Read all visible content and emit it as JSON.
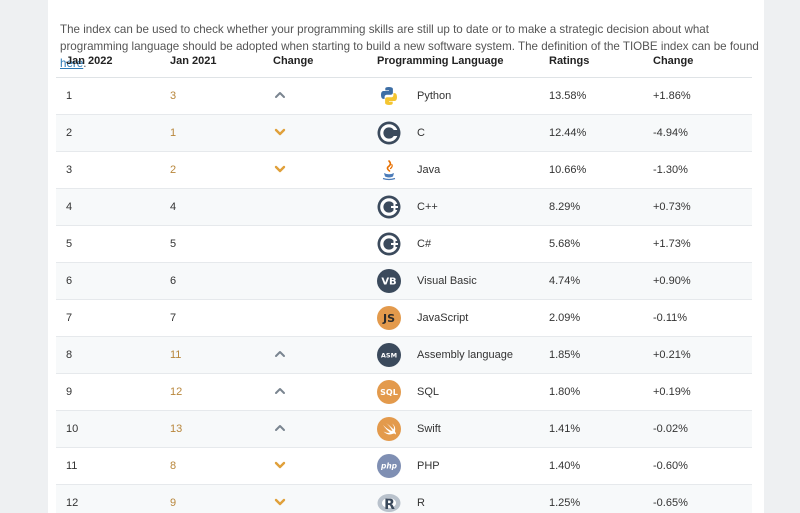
{
  "intro": {
    "text": "The index can be used to check whether your programming skills are still up to date or to make a strategic decision about what programming language should be adopted when starting to build a new software system. The definition of the TIOBE index can be found ",
    "link": "here",
    "end": "."
  },
  "headers": [
    "Jan 2022",
    "Jan 2021",
    "Change",
    "Programming Language",
    "Ratings",
    "Change"
  ],
  "rows": [
    {
      "rank": "1",
      "prev": "3",
      "trend": "up",
      "language": "Python",
      "logo": "python-icon",
      "rating": "13.58%",
      "change": "+1.86%"
    },
    {
      "rank": "2",
      "prev": "1",
      "trend": "down",
      "language": "C",
      "logo": "c-icon",
      "rating": "12.44%",
      "change": "-4.94%"
    },
    {
      "rank": "3",
      "prev": "2",
      "trend": "down",
      "language": "Java",
      "logo": "java-icon",
      "rating": "10.66%",
      "change": "-1.30%"
    },
    {
      "rank": "4",
      "prev": "4",
      "trend": "none",
      "language": "C++",
      "logo": "cplusplus-icon",
      "rating": "8.29%",
      "change": "+0.73%"
    },
    {
      "rank": "5",
      "prev": "5",
      "trend": "none",
      "language": "C#",
      "logo": "csharp-icon",
      "rating": "5.68%",
      "change": "+1.73%"
    },
    {
      "rank": "6",
      "prev": "6",
      "trend": "none",
      "language": "Visual Basic",
      "logo": "visual-basic-icon",
      "logo_text": "VB",
      "rating": "4.74%",
      "change": "+0.90%"
    },
    {
      "rank": "7",
      "prev": "7",
      "trend": "none",
      "language": "JavaScript",
      "logo": "javascript-icon",
      "logo_text": "JS",
      "rating": "2.09%",
      "change": "-0.11%"
    },
    {
      "rank": "8",
      "prev": "11",
      "trend": "up",
      "language": "Assembly language",
      "logo": "assembly-icon",
      "logo_text": "ASM",
      "rating": "1.85%",
      "change": "+0.21%"
    },
    {
      "rank": "9",
      "prev": "12",
      "trend": "up",
      "language": "SQL",
      "logo": "sql-icon",
      "logo_text": "SQL",
      "rating": "1.80%",
      "change": "+0.19%"
    },
    {
      "rank": "10",
      "prev": "13",
      "trend": "up",
      "language": "Swift",
      "logo": "swift-icon",
      "rating": "1.41%",
      "change": "-0.02%"
    },
    {
      "rank": "11",
      "prev": "8",
      "trend": "down",
      "language": "PHP",
      "logo": "php-icon",
      "logo_text": "php",
      "rating": "1.40%",
      "change": "-0.60%"
    },
    {
      "rank": "12",
      "prev": "9",
      "trend": "down",
      "language": "R",
      "logo": "r-icon",
      "logo_text": "R",
      "rating": "1.25%",
      "change": "-0.65%"
    }
  ],
  "colors": {
    "up_arrow": "#7a8590",
    "down_arrow": "#e0a03a",
    "changed_rank": "#b8863b",
    "link": "#2a7ab8"
  }
}
